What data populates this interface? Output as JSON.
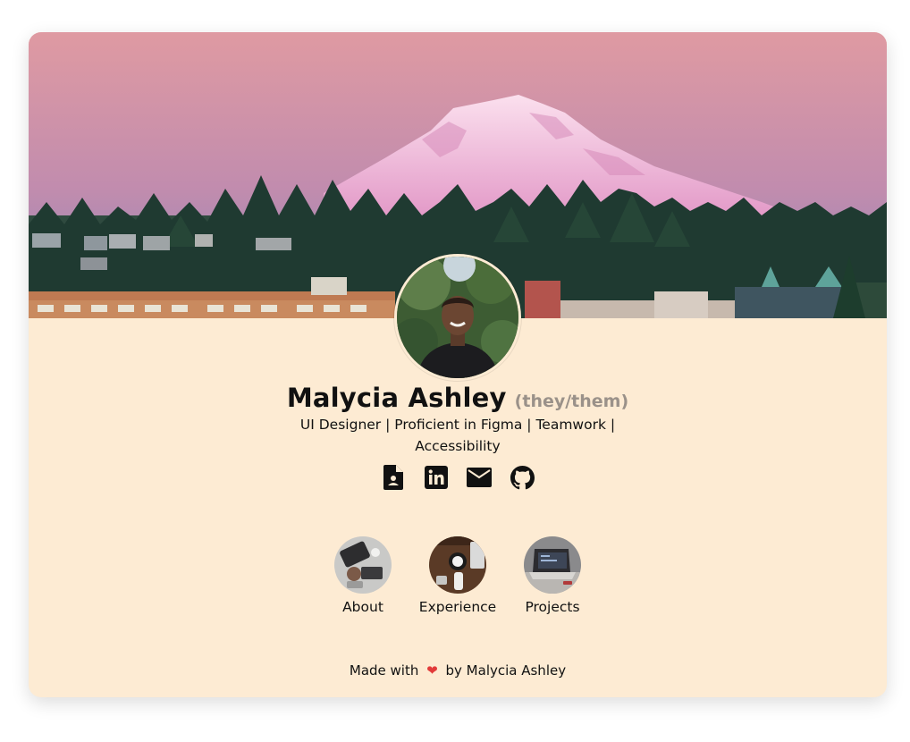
{
  "profile": {
    "name": "Malycia Ashley",
    "pronouns": "(they/them)",
    "tagline": "UI Designer | Proficient in Figma | Teamwork | Accessibility"
  },
  "socials": [
    {
      "icon": "resume-icon"
    },
    {
      "icon": "linkedin-icon"
    },
    {
      "icon": "email-icon"
    },
    {
      "icon": "github-icon"
    }
  ],
  "nav": {
    "items": [
      {
        "label": "About"
      },
      {
        "label": "Experience"
      },
      {
        "label": "Projects"
      }
    ]
  },
  "footer": {
    "prefix": "Made with",
    "heart": "❤",
    "suffix": "by Malycia Ashley"
  },
  "colors": {
    "card_background": "#fdebd3",
    "sky_top": "#dc97a4",
    "sky_bottom": "#8c84b8",
    "heart": "#e23a3a"
  }
}
